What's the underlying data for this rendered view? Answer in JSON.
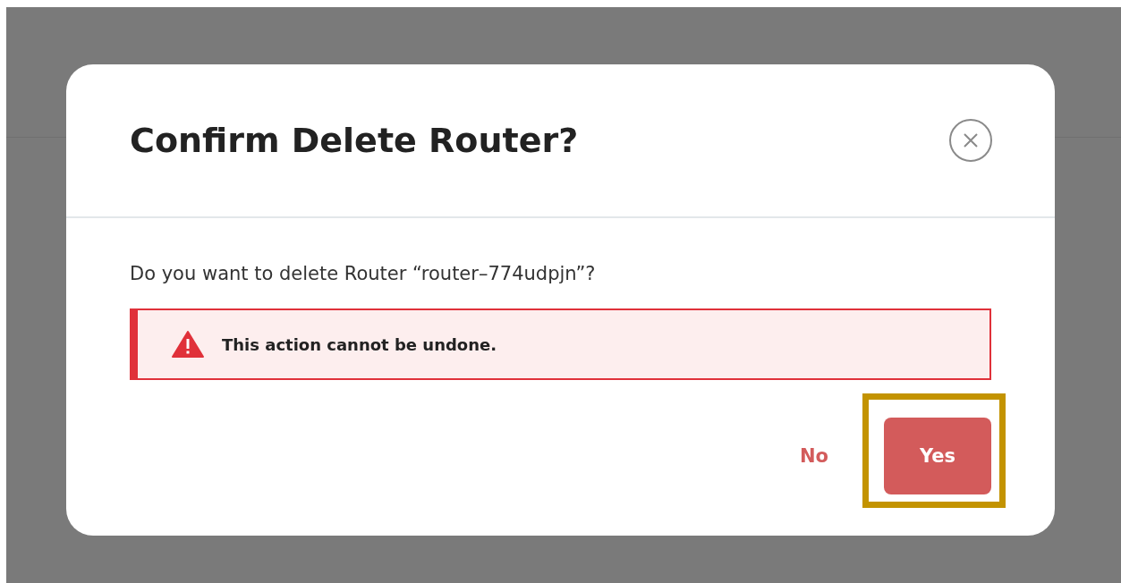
{
  "dialog": {
    "title": "Confirm Delete Router?",
    "message": "Do you want to delete Router “router–774udpjn”?",
    "warning": {
      "text": "This action cannot be undone."
    },
    "buttons": [
      {
        "label": "No",
        "kind": "text",
        "highlighted": false
      },
      {
        "label": "Yes",
        "kind": "primary",
        "highlighted": true
      }
    ]
  }
}
